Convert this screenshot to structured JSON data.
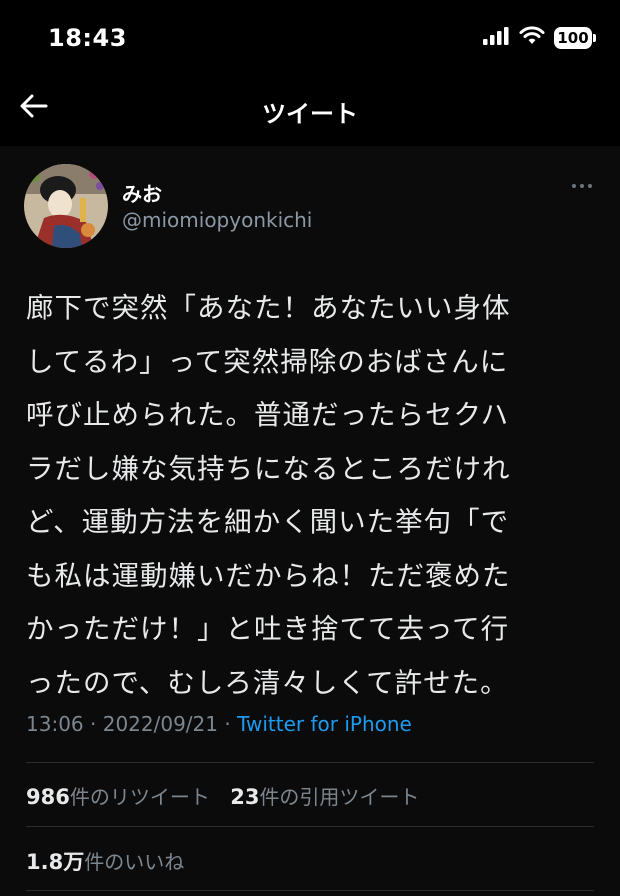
{
  "status_bar": {
    "time": "18:43",
    "battery": "100"
  },
  "nav": {
    "title": "ツイート",
    "back_icon": "arrow-left-icon"
  },
  "tweet": {
    "author": {
      "display_name": "みお",
      "handle": "@miomiopyonkichi"
    },
    "text": "廊下で突然「あなた！あなたいい身体\nしてるわ」って突然掃除のおばさんに\n呼び止められた。普通だったらセクハ\nラだし嫌な気持ちになるところだけれ\nど、運動方法を細かく聞いた挙句「で\nも私は運動嫌いだからね！ただ褒めた\nかっただけ！」と吐き捨てて去って行\nったので、むしろ清々しくて許せた。",
    "time": "13:06",
    "date": "2022/09/21",
    "separator": "·",
    "source": "Twitter for iPhone"
  },
  "stats": {
    "retweets_count": "986",
    "retweets_label": "件のリツイート",
    "quotes_count": "23",
    "quotes_label": "件の引用ツイート",
    "likes_count": "1.8万",
    "likes_label": "件のいいね"
  },
  "colors": {
    "background": "#000000",
    "link": "#1d9bf0",
    "muted": "#7c868f"
  }
}
